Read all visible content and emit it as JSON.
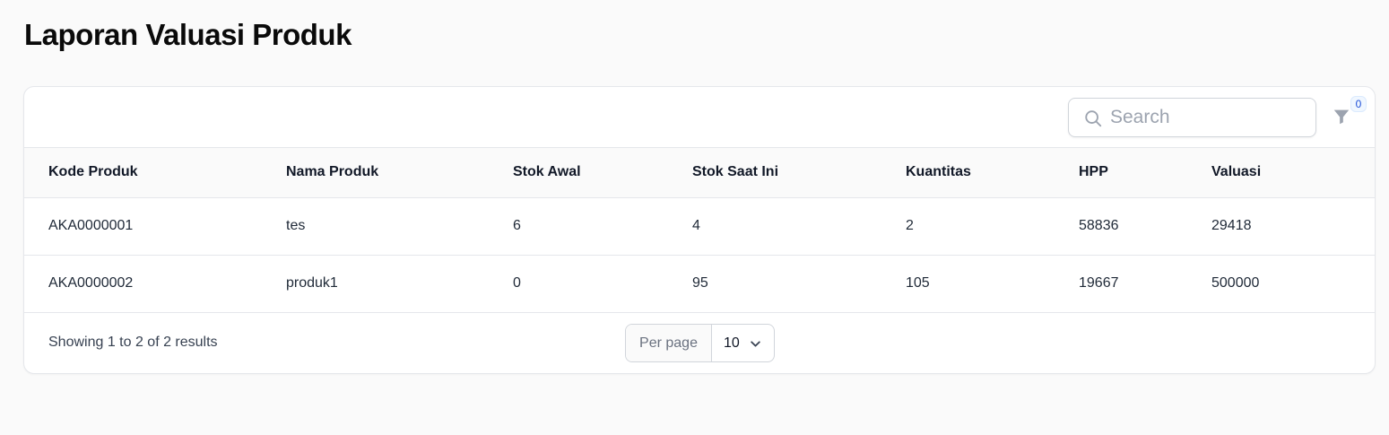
{
  "page": {
    "title": "Laporan Valuasi Produk"
  },
  "toolbar": {
    "search_placeholder": "Search",
    "search_value": "",
    "filter_count": "0"
  },
  "table": {
    "columns": [
      "Kode Produk",
      "Nama Produk",
      "Stok Awal",
      "Stok Saat Ini",
      "Kuantitas",
      "HPP",
      "Valuasi"
    ],
    "rows": [
      [
        "AKA0000001",
        "tes",
        "6",
        "4",
        "2",
        "58836",
        "29418"
      ],
      [
        "AKA0000002",
        "produk1",
        "0",
        "95",
        "105",
        "19667",
        "500000"
      ]
    ]
  },
  "footer": {
    "results_text": "Showing 1 to 2 of 2 results",
    "per_page_label": "Per page",
    "per_page_value": "10"
  },
  "icons": {
    "search": "search-icon",
    "filter": "filter-icon",
    "chevron": "chevron-down-icon"
  },
  "colors": {
    "background": "#fafafa",
    "card": "#ffffff",
    "border": "#e5e7eb",
    "badge_text": "#1d4ed8"
  }
}
